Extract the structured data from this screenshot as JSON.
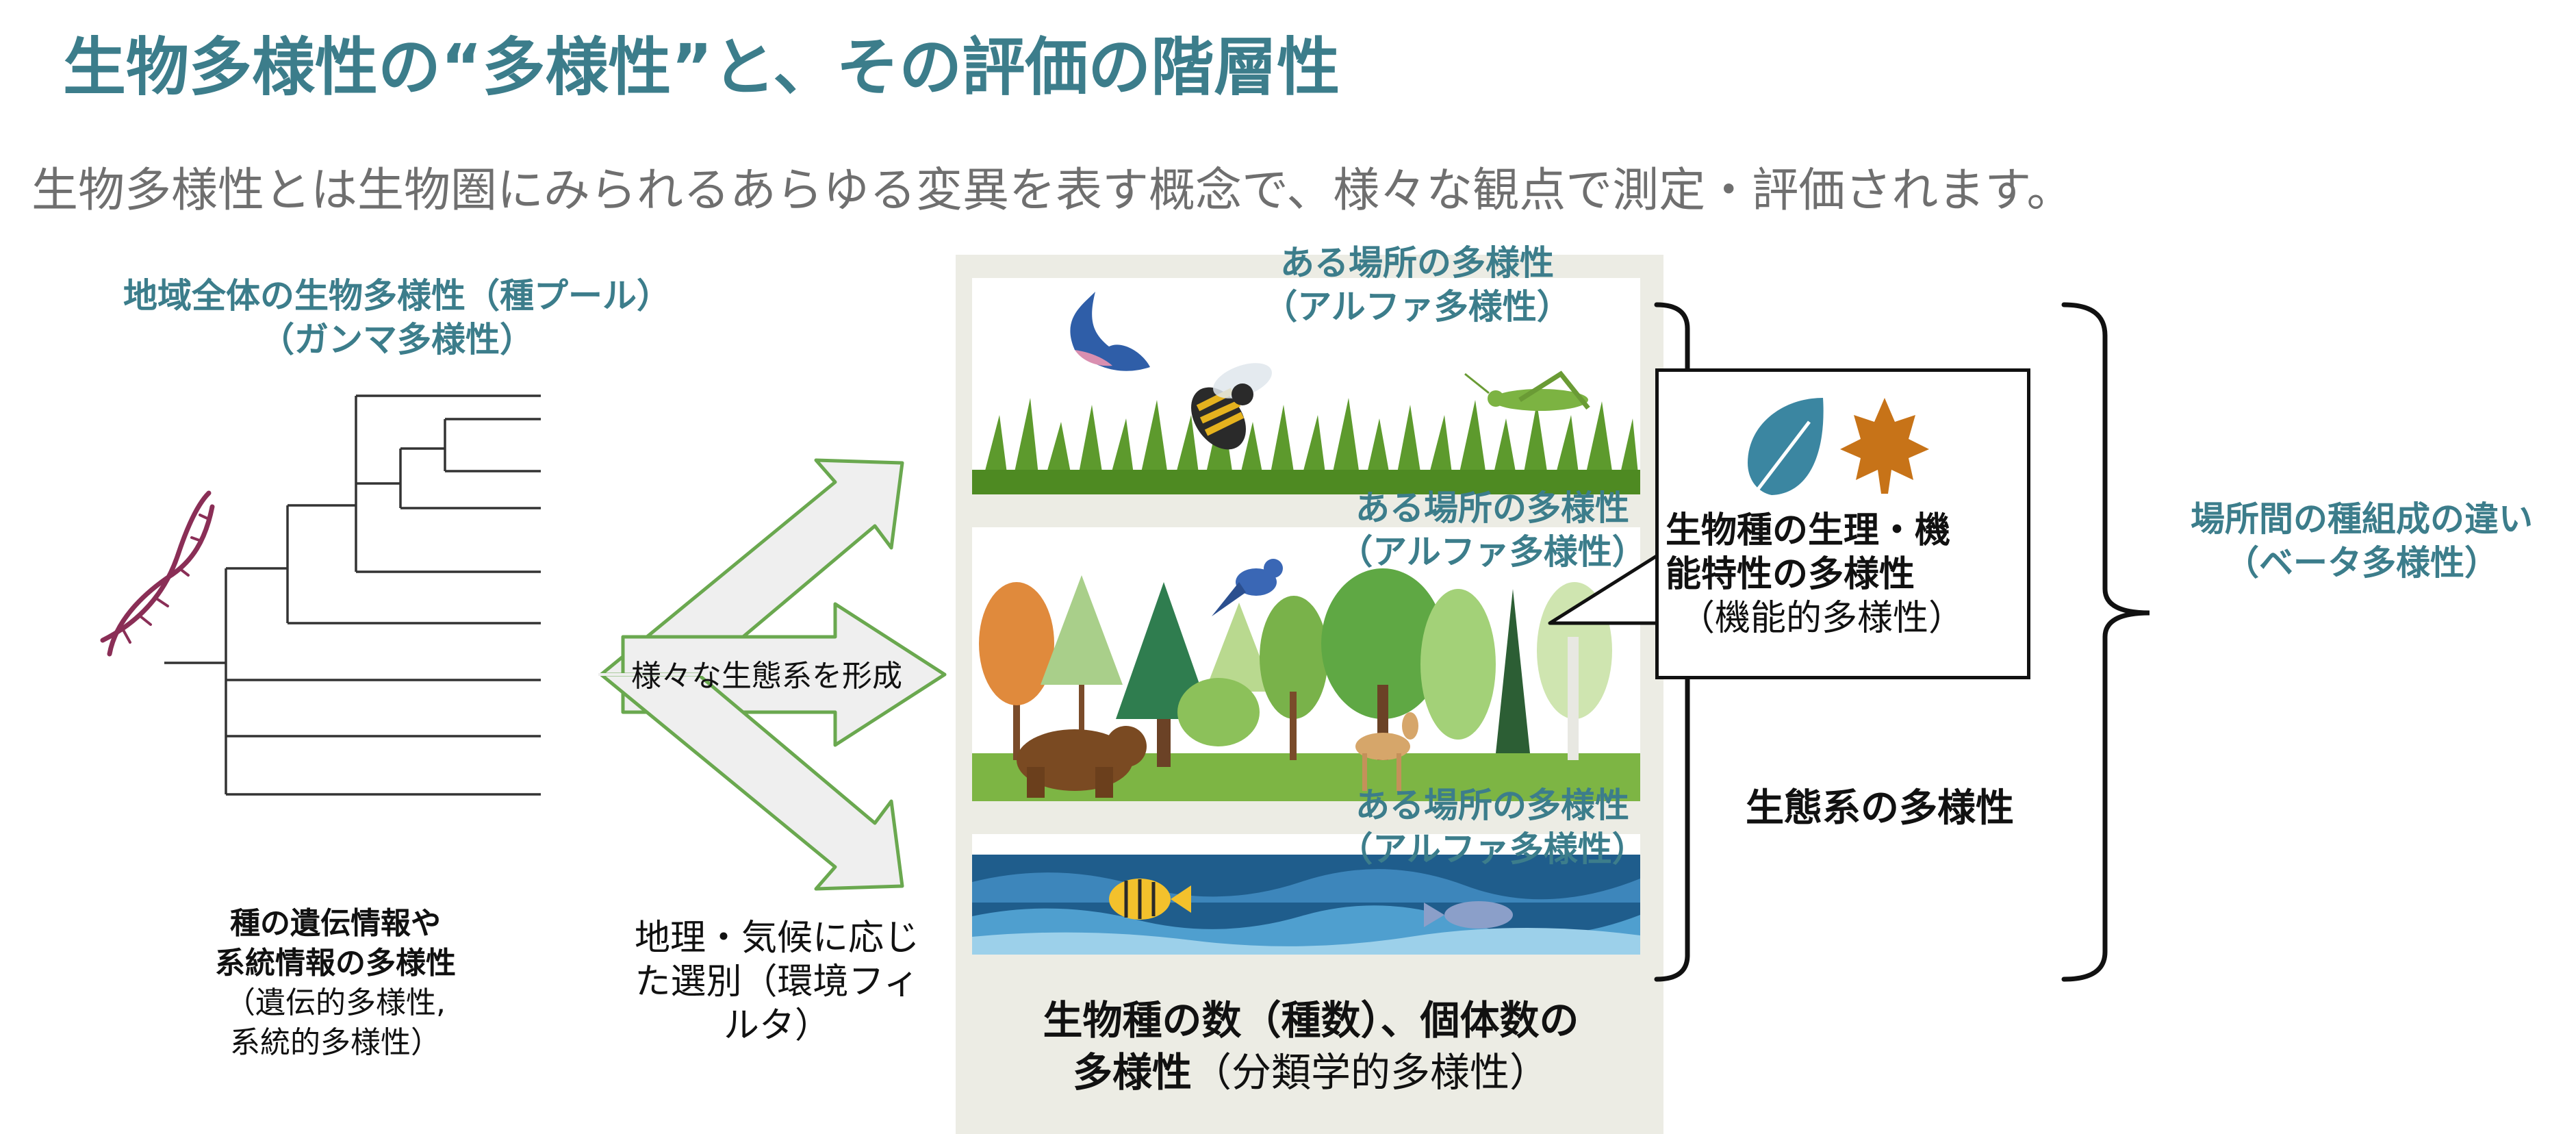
{
  "header": {
    "title": "生物多様性の“多様性”と、その評価の階層性",
    "subtitle": "生物多様性とは生物圏にみられるあらゆる変異を表す概念で、様々な観点で測定・評価されます。"
  },
  "gamma": {
    "line1": "地域全体の生物多様性（種プール）",
    "line2": "（ガンマ多様性）"
  },
  "genetic": {
    "line1": "種の遺伝情報や",
    "line2": "系統情報の多様性",
    "line3": "（遺伝的多様性,",
    "line4": "系統的多様性）"
  },
  "arrows": {
    "middle_label": "様々な生態系を形成"
  },
  "filter": {
    "line1": "地理・気候に応じ",
    "line2": "た選別（環境フィ",
    "line3": "ルタ）"
  },
  "alpha": [
    {
      "line1": "ある場所の多様性",
      "line2": "（アルファ多様性）"
    },
    {
      "line1": "ある場所の多様性",
      "line2": "（アルファ多様性）"
    },
    {
      "line1": "ある場所の多様性",
      "line2": "（アルファ多様性）"
    }
  ],
  "functional": {
    "line1": "生物種の生理・機",
    "line2": "能特性の多様性",
    "line3": "（機能的多様性）"
  },
  "ecosystem": {
    "label": "生態系の多様性"
  },
  "beta": {
    "line1": "場所間の種組成の違い",
    "line2": "（ベータ多様性）"
  },
  "taxonomic": {
    "line1": "生物種の数（種数）、個体数の",
    "line2_bold": "多様性",
    "line2_rest": "（分類学的多様性）"
  },
  "colors": {
    "title": "#3c7d8b",
    "subtitle": "#6f6f6f",
    "teal_label": "#3c7d8b",
    "arrow_stroke": "#6aa84f",
    "arrow_fill": "#efefef",
    "panel_bg": "#ecece4",
    "dna": "#8a2e56"
  },
  "icons": [
    "dna-icon",
    "bird-icon",
    "bee-icon",
    "grasshopper-icon",
    "leaf-icon",
    "maple-leaf-icon",
    "bear-icon",
    "deer-icon",
    "fish-icon"
  ]
}
